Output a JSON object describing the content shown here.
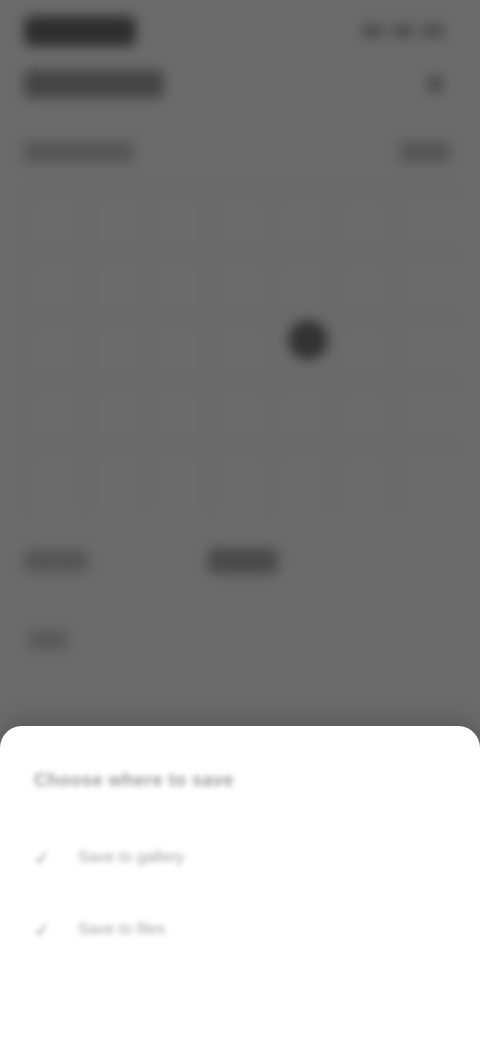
{
  "background_app": {
    "title": "",
    "subtitle": ""
  },
  "sheet": {
    "title": "Choose where to save",
    "items": [
      {
        "label": "Save to gallery",
        "icon": "checkmark-icon"
      },
      {
        "label": "Save to files",
        "icon": "checkmark-icon"
      }
    ]
  },
  "colors": {
    "scrim": "#6b6b6b",
    "sheet_background": "#ffffff",
    "muted_text": "#9a9a9a"
  }
}
